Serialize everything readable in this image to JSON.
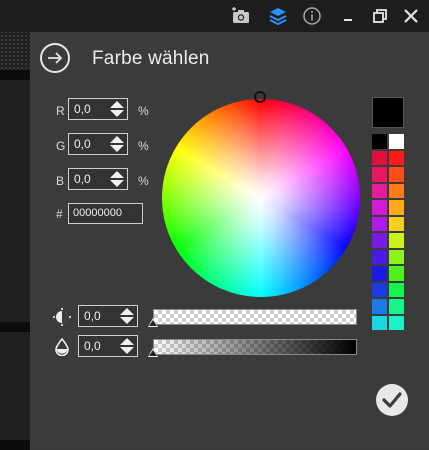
{
  "window": {
    "toolbar_icons": [
      "camera-plus-icon",
      "layers-icon",
      "info-icon"
    ],
    "window_controls": [
      "minimize-icon",
      "restore-icon",
      "close-icon"
    ]
  },
  "dialog": {
    "title": "Farbe wählen",
    "back_icon": "arrow-right-circle-icon"
  },
  "rgb": {
    "r": {
      "label": "R",
      "value": "0,0",
      "unit": "%"
    },
    "g": {
      "label": "G",
      "value": "0,0",
      "unit": "%"
    },
    "b": {
      "label": "B",
      "value": "0,0",
      "unit": "%"
    }
  },
  "hex": {
    "label": "#",
    "value": "00000000"
  },
  "preview_color": "#000000",
  "palette": [
    "#000000",
    "#ffffff",
    "#e0103a",
    "#ff1a1a",
    "#e81563",
    "#ff4d1a",
    "#e61a9a",
    "#ff7a1a",
    "#d11ad6",
    "#ffaa1a",
    "#b01ae6",
    "#f2d21a",
    "#7a1ae6",
    "#c8f21a",
    "#4a1ae6",
    "#8cf21a",
    "#1a1ae6",
    "#4df21a",
    "#1a3ae6",
    "#1af24d",
    "#1a7ae6",
    "#1af28c",
    "#1ad6e6",
    "#1af2c8"
  ],
  "brightness": {
    "icon": "brightness-icon",
    "value": "0,0",
    "level": 0
  },
  "opacity": {
    "icon": "water-drop-icon",
    "value": "0,0",
    "level": 0
  },
  "ok_icon": "checkmark-icon"
}
